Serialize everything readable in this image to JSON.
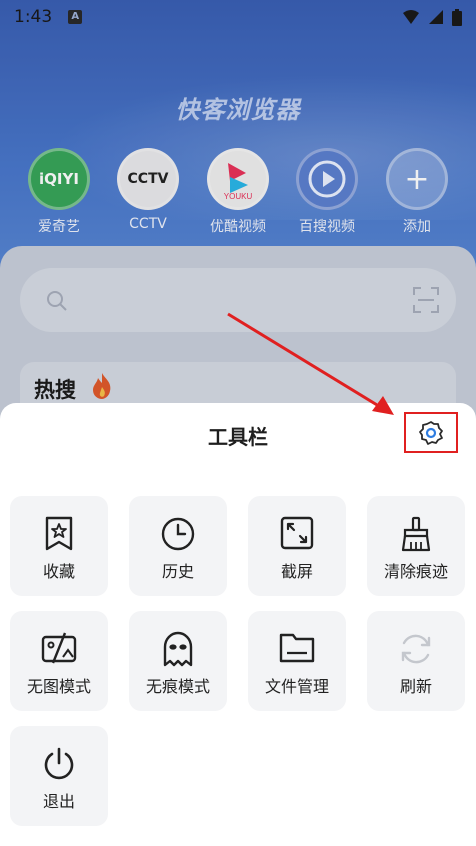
{
  "status_bar": {
    "time": "1:43",
    "notif_badge": "A"
  },
  "home": {
    "title": "快客浏览器",
    "shortcuts": [
      {
        "label": "爱奇艺",
        "logo_text": "iQIYI",
        "icon": "iqiyi-logo"
      },
      {
        "label": "CCTV",
        "logo_text": "CCTV",
        "icon": "cctv-logo"
      },
      {
        "label": "优酷视频",
        "logo_text": "YOUKU",
        "icon": "youku-logo"
      },
      {
        "label": "百搜视频",
        "icon": "play-circle-logo"
      },
      {
        "label": "添加",
        "icon": "plus-icon"
      }
    ],
    "hot_title": "热搜"
  },
  "toolbar": {
    "title": "工具栏",
    "settings_icon": "gear-icon",
    "items": [
      {
        "label": "收藏",
        "icon": "bookmark-star-icon"
      },
      {
        "label": "历史",
        "icon": "clock-icon"
      },
      {
        "label": "截屏",
        "icon": "screenshot-icon"
      },
      {
        "label": "清除痕迹",
        "icon": "broom-icon"
      },
      {
        "label": "无图模式",
        "icon": "no-image-icon"
      },
      {
        "label": "无痕模式",
        "icon": "incognito-ghost-icon"
      },
      {
        "label": "文件管理",
        "icon": "folder-icon"
      },
      {
        "label": "刷新",
        "icon": "refresh-icon"
      },
      {
        "label": "退出",
        "icon": "power-icon"
      }
    ]
  },
  "colors": {
    "annotation_red": "#e02020",
    "accent_blue": "#2f7de1",
    "sheet_bg": "#ffffff",
    "tile_bg": "#f3f4f6"
  }
}
